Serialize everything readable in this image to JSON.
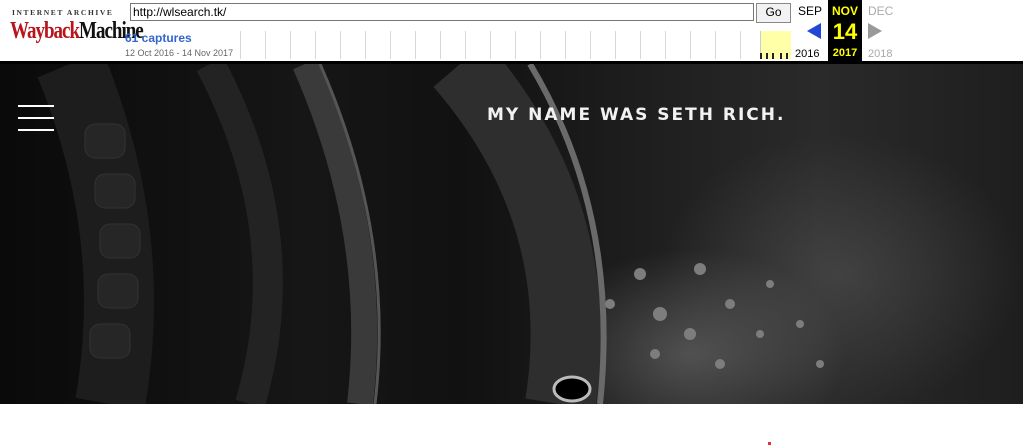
{
  "wayback": {
    "logo_top": "INTERNET ARCHIVE",
    "logo_word_1": "Wayback",
    "logo_word_2": "Machine",
    "url_value": "http://wlsearch.tk/",
    "go_label": "Go",
    "captures_label": "61 captures",
    "date_range": "12 Oct 2016 - 14 Nov 2017",
    "prev_month": "SEP",
    "current_month": "NOV",
    "next_month": "DEC",
    "current_day": "14",
    "prev_year": "2016",
    "current_year": "2017",
    "next_year": "2018",
    "prev_arrow_icon": "triangle-left-icon",
    "next_arrow_icon": "triangle-right-icon",
    "colors": {
      "logo_red": "#b8141b",
      "captures_blue": "#3366cc",
      "highlight_yellow": "#ffff00",
      "prev_arrow_blue": "#2146d8"
    }
  },
  "site": {
    "title": "MY NAME WAS SETH RICH.",
    "menu_icon": "hamburger-menu-icon"
  }
}
